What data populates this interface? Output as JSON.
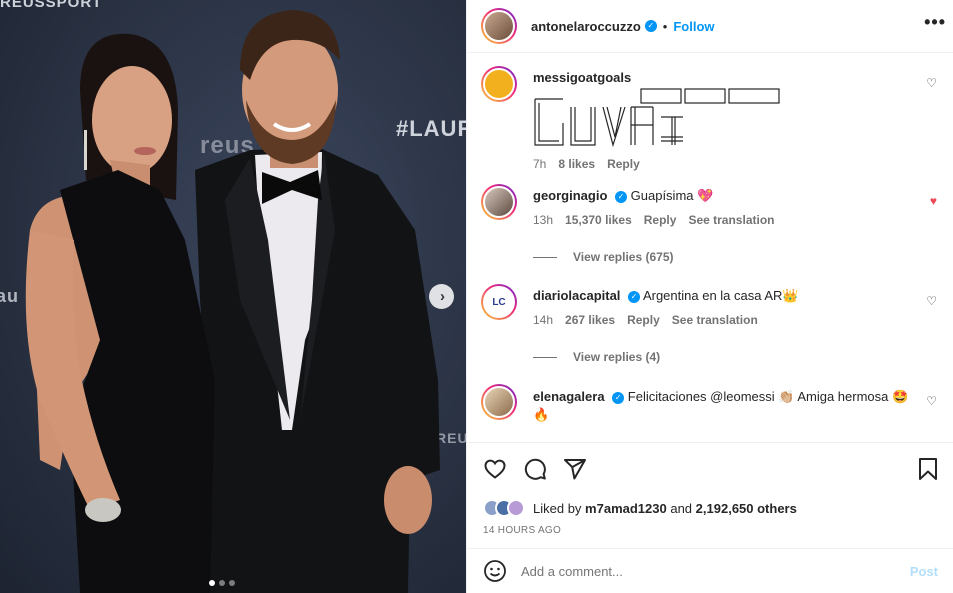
{
  "header": {
    "username": "antonelaroccuzzo",
    "separator": "•",
    "follow_label": "Follow",
    "more_icon": "more-horizontal-icon"
  },
  "media": {
    "watermarks": {
      "top": "REUSSPORT",
      "right_hashtag": "#LAUR",
      "center": "reus",
      "right_small": "REUSS",
      "left": "au"
    },
    "carousel_dots": 3,
    "active_dot": 1
  },
  "comments": [
    {
      "username": "messigoatgoals",
      "text": "",
      "time": "7h",
      "likes": "8 likes",
      "reply_label": "Reply",
      "liked": false
    },
    {
      "username": "georginagio",
      "verified": true,
      "text": "Guapísima 💖",
      "time": "13h",
      "likes": "15,370 likes",
      "reply_label": "Reply",
      "translate_label": "See translation",
      "liked": true,
      "view_replies": "View replies (675)"
    },
    {
      "username": "diariolacapital",
      "verified": true,
      "text": "Argentina en la casa AR👑",
      "time": "14h",
      "likes": "267 likes",
      "reply_label": "Reply",
      "translate_label": "See translation",
      "liked": false,
      "view_replies": "View replies (4)"
    },
    {
      "username": "elenagalera",
      "verified": true,
      "text": "Felicitaciones @leomessi 👏🏼 Amiga hermosa 🤩🔥",
      "time": "",
      "likes": "",
      "liked": false
    }
  ],
  "actions": {
    "liked_by_prefix": "Liked by",
    "liked_by_user": "m7amad1230",
    "liked_by_and": "and",
    "liked_by_others": "2,192,650 others",
    "timestamp": "14 HOURS AGO"
  },
  "add_comment": {
    "placeholder": "Add a comment...",
    "post_label": "Post"
  },
  "colors": {
    "accent": "#0095f6",
    "like_red": "#ed4956",
    "muted": "#737373",
    "post_disabled": "#b2dffc"
  }
}
